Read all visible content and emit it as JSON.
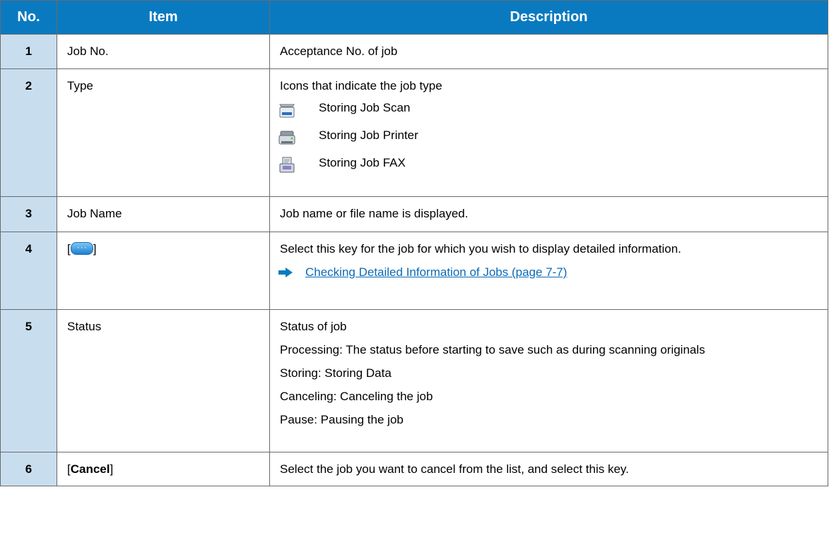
{
  "headers": {
    "no": "No.",
    "item": "Item",
    "description": "Description"
  },
  "rows": [
    {
      "no": "1",
      "item": "Job No.",
      "desc": "Acceptance No. of job"
    },
    {
      "no": "2",
      "item": "Type",
      "desc": "Icons that indicate the job type",
      "types": [
        {
          "label": "Storing Job Scan",
          "icon": "scanner-icon"
        },
        {
          "label": "Storing Job Printer",
          "icon": "printer-icon"
        },
        {
          "label": "Storing Job FAX",
          "icon": "fax-icon"
        }
      ]
    },
    {
      "no": "3",
      "item": "Job Name",
      "desc": "Job name or file name is displayed."
    },
    {
      "no": "4",
      "item_prefix": "[",
      "item_suffix": "]",
      "item_icon": "detail-key-icon",
      "desc": "Select this key for the job for which you wish to display detailed information.",
      "link": "Checking Detailed Information of Jobs (page 7-7)"
    },
    {
      "no": "5",
      "item": "Status",
      "lines": [
        "Status of job",
        "Processing: The status before starting to save such as during scanning originals",
        "Storing: Storing Data",
        "Canceling: Canceling the job",
        "Pause: Pausing the job"
      ]
    },
    {
      "no": "6",
      "item_prefix": "[",
      "item_bold": "Cancel",
      "item_suffix": "]",
      "desc": "Select the job you want to cancel from the list, and select this key."
    }
  ]
}
